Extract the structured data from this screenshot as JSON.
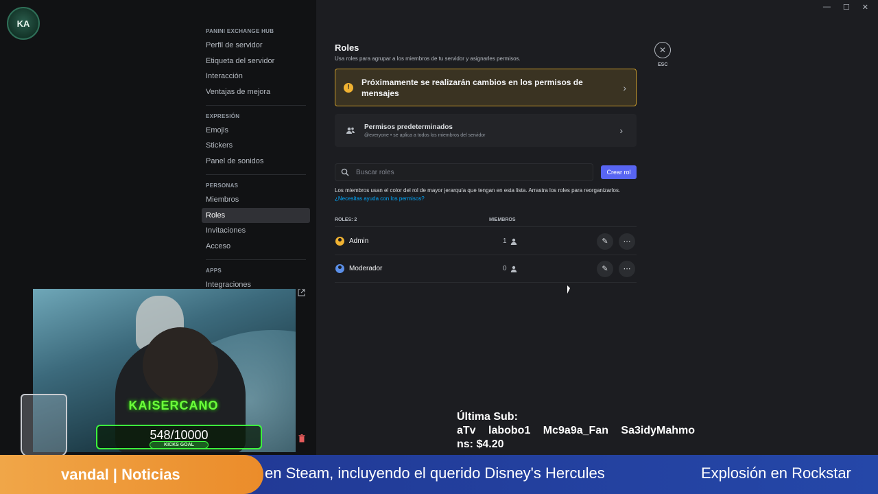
{
  "window": {
    "controls": [
      "—",
      "☐",
      "✕"
    ]
  },
  "sidebar": {
    "server_logo_text": "KA",
    "sections": [
      {
        "heading": "PANINI EXCHANGE HUB",
        "items": [
          "Perfil de servidor",
          "Etiqueta del servidor",
          "Interacción",
          "Ventajas de mejora"
        ]
      },
      {
        "heading": "EXPRESIÓN",
        "items": [
          "Emojis",
          "Stickers",
          "Panel de sonidos"
        ]
      },
      {
        "heading": "PERSONAS",
        "items": [
          "Miembros",
          "Roles",
          "Invitaciones",
          "Acceso"
        ]
      },
      {
        "heading": "APPS",
        "items": [
          "Integraciones"
        ]
      }
    ],
    "active_item": "Roles"
  },
  "main": {
    "title": "Roles",
    "description": "Usa roles para agrupar a los miembros de tu servidor y asignarles permisos.",
    "banner": {
      "text": "Próximamente se realizarán cambios en los permisos de mensajes",
      "color": "#c99b2b"
    },
    "defaults": {
      "title": "Permisos predeterminados",
      "subtitle": "@everyone • se aplica a todos los miembros del servidor"
    },
    "search": {
      "placeholder": "Buscar roles"
    },
    "create_button": "Crear rol",
    "hint_text": "Los miembros usan el color del rol de mayor jerarquía que tengan en esta lista. Arrastra los roles para reorganizarlos.",
    "hint_link": "¿Necesitas ayuda con los permisos?",
    "table": {
      "roles_header": "ROLES: 2",
      "members_header": "MIEMBROS",
      "rows": [
        {
          "name": "Admin",
          "members": "1",
          "color": "#f0b232"
        },
        {
          "name": "Moderador",
          "members": "0",
          "color": "#5b8fe8"
        }
      ]
    },
    "esc_label": "ESC"
  },
  "overlay": {
    "streamer_name": "KAISERCANO",
    "goal_value": "548/10000",
    "goal_label": "KICKS GOAL",
    "last_sub_title": "Última Sub:",
    "last_sub_names": "aTv labobo1 Mc9a9a_Fan Sa3idyMahmo",
    "last_sub_extra": "ns: $4.20",
    "ticker_brand": "vandal | Noticias",
    "ticker_text": "en Steam, incluyendo el querido Disney's Hercules",
    "ticker_text_2": "Explosión en Rockstar"
  }
}
